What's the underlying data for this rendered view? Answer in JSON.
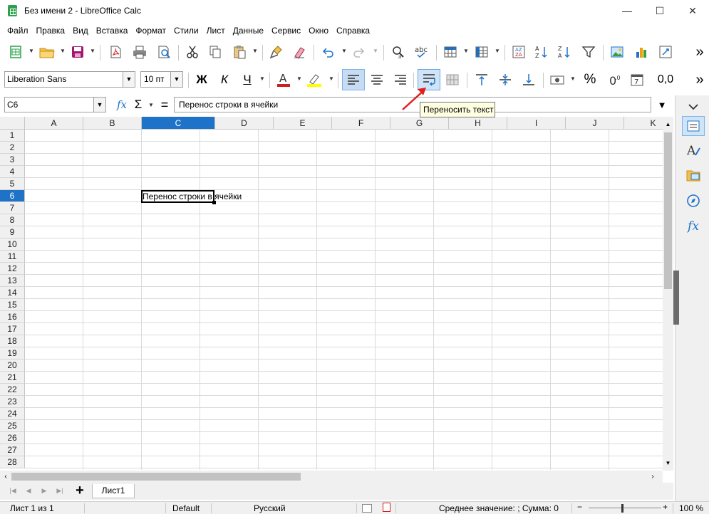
{
  "window": {
    "title": "Без имени 2 - LibreOffice Calc",
    "minimize": "—",
    "maximize": "☐",
    "close": "✕"
  },
  "menu": [
    "Файл",
    "Правка",
    "Вид",
    "Вставка",
    "Формат",
    "Стили",
    "Лист",
    "Данные",
    "Сервис",
    "Окно",
    "Справка"
  ],
  "format_toolbar": {
    "font_name": "Liberation Sans",
    "font_size": "10 пт",
    "bold": "Ж",
    "italic": "К",
    "underline": "Ч",
    "percent": "%",
    "decimal": "0,0",
    "wrap_text_active": true,
    "font_color": "#c9211e",
    "highlight_color": "#ffff00"
  },
  "formula_bar": {
    "name_box": "C6",
    "fx": "fx",
    "sum": "Σ",
    "equals": "=",
    "content": "Перенос строки в ячейки"
  },
  "tooltip": "Переносить текст",
  "columns": [
    "A",
    "B",
    "C",
    "D",
    "E",
    "F",
    "G",
    "H",
    "I",
    "J",
    "K"
  ],
  "selected_column": "C",
  "rows": [
    "1",
    "2",
    "3",
    "4",
    "5",
    "6",
    "7",
    "8",
    "9",
    "10",
    "11",
    "12",
    "13",
    "14",
    "15",
    "16",
    "17",
    "18",
    "19",
    "20",
    "21",
    "22",
    "23",
    "24",
    "25",
    "26",
    "27",
    "28"
  ],
  "selected_row": "6",
  "active_cell": {
    "ref": "C6",
    "text": "Перенос строки в ячейки"
  },
  "sheet_tabs": {
    "add": "+",
    "tabs": [
      "Лист1"
    ]
  },
  "statusbar": {
    "sheet": "Лист 1 из 1",
    "style": "Default",
    "language": "Русский",
    "summary": "Среднее значение: ; Сумма: 0",
    "zoom": "100 %",
    "zoom_minus": "−",
    "zoom_plus": "+"
  },
  "accent": "#1e72c8",
  "more": "»"
}
